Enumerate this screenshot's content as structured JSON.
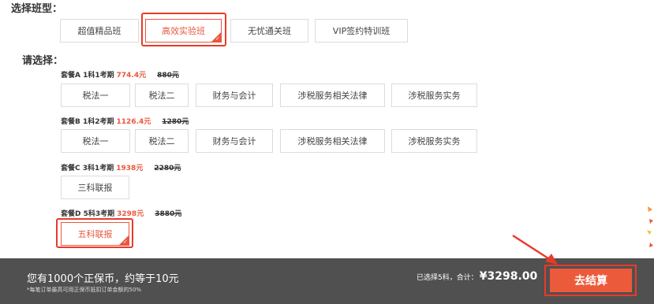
{
  "class_section": {
    "title": "选择班型：",
    "options": [
      {
        "label": "超值精品班",
        "selected": false
      },
      {
        "label": "高效实验班",
        "selected": true
      },
      {
        "label": "无忧通关班",
        "selected": false
      },
      {
        "label": "VIP签约特训班",
        "selected": false
      }
    ]
  },
  "select_section": {
    "title": "请选择："
  },
  "packages": [
    {
      "name": "套餐A 1科1考期",
      "price": "774.4元",
      "old_price": "880元",
      "subjects": [
        "税法一",
        "税法二",
        "财务与会计",
        "涉税服务相关法律",
        "涉税服务实务"
      ]
    },
    {
      "name": "套餐B 1科2考期",
      "price": "1126.4元",
      "old_price": "1280元",
      "subjects": [
        "税法一",
        "税法二",
        "财务与会计",
        "涉税服务相关法律",
        "涉税服务实务"
      ]
    },
    {
      "name": "套餐C 3科1考期",
      "price": "1938元",
      "old_price": "2280元",
      "subjects": [
        "三科联报"
      ]
    },
    {
      "name": "套餐D 5科3考期",
      "price": "3298元",
      "old_price": "3880元",
      "subjects": [
        "五科联报"
      ],
      "selected_subject": 0
    }
  ],
  "bottom_bar": {
    "coin_text": "您有1000个正保币，约等于10元",
    "coin_note": "*每笔订单最高可用正保币抵扣订单金额的50%",
    "summary_label": "已选择5科，合计：",
    "total": "¥3298.00",
    "checkout_label": "去结算"
  },
  "colors": {
    "accent": "#e8573f",
    "highlight_red": "#e83a2a",
    "bar_bg": "#505050",
    "button_bg": "#ec5a3c"
  }
}
